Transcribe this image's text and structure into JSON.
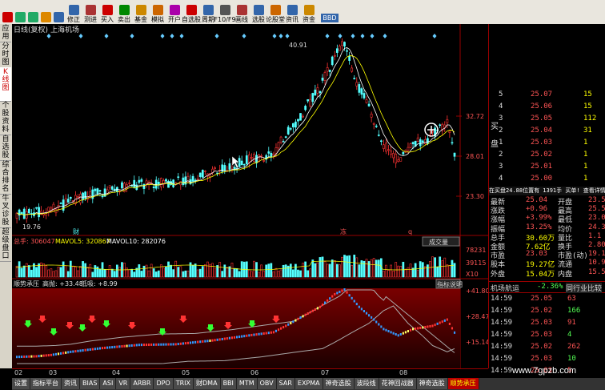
{
  "toolbar": {
    "items": [
      {
        "label": "",
        "icon": "logo-icon"
      },
      {
        "label": "",
        "icon": "back-icon"
      },
      {
        "label": "",
        "icon": "forward-icon"
      },
      {
        "label": "",
        "icon": "home-icon"
      },
      {
        "label": "",
        "icon": "zoom-icon"
      },
      {
        "label": "修正",
        "icon": "edit-icon"
      },
      {
        "label": "测进",
        "icon": "chart-icon"
      },
      {
        "label": "买入",
        "icon": "buy-icon"
      },
      {
        "label": "卖出",
        "icon": "sell-icon"
      },
      {
        "label": "基金",
        "icon": "fund-icon"
      },
      {
        "label": "模拟",
        "icon": "simulate-icon"
      },
      {
        "label": "开户",
        "icon": "account-icon"
      },
      {
        "label": "自选股",
        "icon": "watchlist-icon"
      },
      {
        "label": "周期",
        "icon": "period-icon"
      },
      {
        "label": "F10/F9",
        "icon": "f10-icon"
      },
      {
        "label": "画线",
        "icon": "draw-icon"
      },
      {
        "label": "选股",
        "icon": "screen-icon"
      },
      {
        "label": "论股堂",
        "icon": "forum-icon"
      },
      {
        "label": "资讯",
        "icon": "news-icon"
      },
      {
        "label": "资金",
        "icon": "capital-icon"
      }
    ],
    "bbd_label": "BBD"
  },
  "sidebar": {
    "tabs": [
      "应用",
      "分时图",
      "K线图",
      "个股资料",
      "自选股",
      "综合排名",
      "牛叉诊股",
      "超级盘口"
    ]
  },
  "chart_header": {
    "period": "日线(复权)",
    "name": "上海机场"
  },
  "price_chart": {
    "high_label": "40.91",
    "low_label": "19.76",
    "y_labels": [
      "32.72",
      "28.01",
      "23.30"
    ],
    "markers": [
      "财",
      "冻",
      "q"
    ]
  },
  "volume_chart": {
    "total_label": "总手: 306047",
    "mavol5_label": "MAVOL5: 320867",
    "mavol10_label": "MAVOL10: 282076",
    "button": "成交量",
    "y_labels": [
      "78231",
      "39115",
      "X10"
    ]
  },
  "indicator_chart": {
    "name": "顺势承压",
    "high_label": "高抛: +33.48",
    "low_label": "低吸: +8.99",
    "button": "指标说明",
    "y_labels": [
      "+41.80",
      "+28.47",
      "+15.14"
    ]
  },
  "date_axis": [
    "02",
    "03",
    "04",
    "05",
    "06",
    "07",
    "08"
  ],
  "bottom_tabs": [
    "设置",
    "指标平台",
    "资讯",
    "BIAS",
    "ASI",
    "VR",
    "ARBR",
    "DPO",
    "TRIX",
    "财DMA",
    "BBI",
    "MTM",
    "OBV",
    "SAR",
    "EXPMA",
    "神奇选股",
    "波段线",
    "花神回战器",
    "神奇选股",
    "顺势承压"
  ],
  "order_book": {
    "sell": [
      {
        "level": "5",
        "price": "25.07",
        "vol": "15"
      },
      {
        "level": "4",
        "price": "25.06",
        "vol": "15"
      },
      {
        "level": "3",
        "price": "25.05",
        "vol": "112"
      },
      {
        "level": "2",
        "price": "25.04",
        "vol": "31"
      }
    ],
    "side_labels": [
      "买",
      "盘"
    ],
    "buy": [
      {
        "level": "1",
        "price": "25.03",
        "vol": "1"
      },
      {
        "level": "2",
        "price": "25.02",
        "vol": "1"
      },
      {
        "level": "3",
        "price": "25.01",
        "vol": "1"
      },
      {
        "level": "4",
        "price": "25.00",
        "vol": "1"
      }
    ]
  },
  "summary_bar": "在买盘24.88位置有  1391手  买单! 查看详情",
  "quote": {
    "rows": [
      [
        "最新",
        "25.04",
        "开盘",
        "23.5"
      ],
      [
        "涨跌",
        "+0.96",
        "最高",
        "25.5"
      ],
      [
        "涨幅",
        "+3.99%",
        "最低",
        "23.0"
      ],
      [
        "振幅",
        "13.25%",
        "均价",
        "24.3"
      ],
      [
        "总手",
        "30.60万",
        "量比",
        "1.1"
      ],
      [
        "金额",
        "7.62亿",
        "换手",
        "2.80"
      ],
      [
        "市盈",
        "23.03",
        "市盈(动)",
        "19.1"
      ],
      [
        "股本",
        "19.27亿",
        "流通",
        "10.9"
      ],
      [
        "外盘",
        "15.04万",
        "内盘",
        "15.5"
      ]
    ]
  },
  "industry": {
    "name": "机场航运",
    "change": "-2.36%",
    "button": "同行业比较"
  },
  "ticks": [
    {
      "time": "14:59",
      "price": "25.05",
      "vol": "63"
    },
    {
      "time": "14:59",
      "price": "25.02",
      "vol": "166"
    },
    {
      "time": "14:59",
      "price": "25.03",
      "vol": "91"
    },
    {
      "time": "14:59",
      "price": "25.03",
      "vol": "4"
    },
    {
      "time": "14:59",
      "price": "25.02",
      "vol": "262"
    },
    {
      "time": "14:59",
      "price": "25.03",
      "vol": "10"
    },
    {
      "time": "14:59",
      "price": "25.03",
      "vol": "5"
    }
  ],
  "watermark": "www.7gpzb.com",
  "colors": {
    "up": "#ff3333",
    "down": "#54ffff",
    "ma_white": "#ffffff",
    "ma_yellow": "#ffff00",
    "indicator_bg": "#5a0000"
  }
}
